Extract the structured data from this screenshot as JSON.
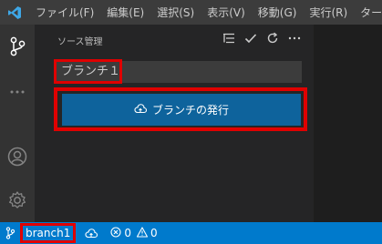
{
  "menubar": {
    "items": [
      "ファイル(F)",
      "編集(E)",
      "選択(S)",
      "表示(V)",
      "移動(G)",
      "実行(R)",
      "ターミ"
    ]
  },
  "activity": {
    "icons": [
      "source-control-icon",
      "more-icon",
      "account-icon",
      "settings-gear-icon"
    ]
  },
  "panel": {
    "title": "ソース管理",
    "commit_input_value": "ブランチ１",
    "publish_button_label": "ブランチの発行"
  },
  "statusbar": {
    "branch": "branch1",
    "errors": "0",
    "warnings": "0"
  },
  "colors": {
    "accent": "#007acc",
    "button": "#0e639c",
    "highlight": "#e00000"
  }
}
